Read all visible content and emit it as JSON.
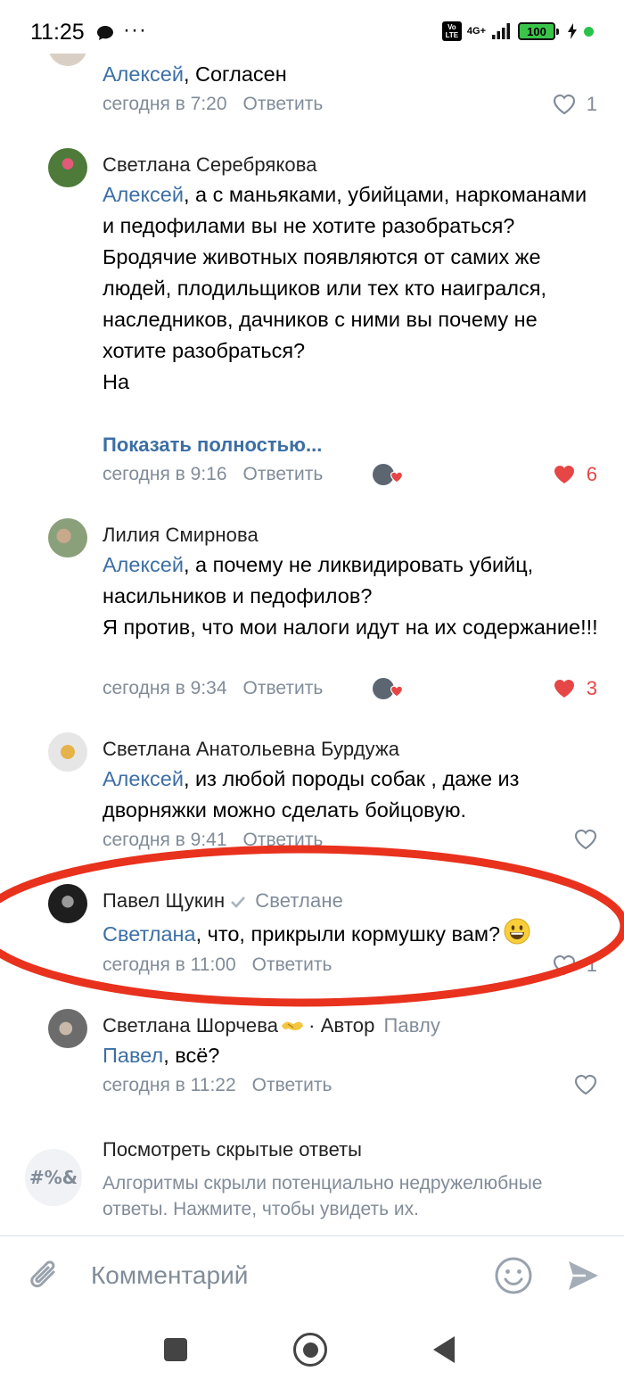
{
  "status_bar": {
    "time": "11:25",
    "volte": "Vo LTE",
    "network": "4G+",
    "battery": "100"
  },
  "comments": [
    {
      "author": "",
      "mention": "Алексей",
      "text": ", Согласен",
      "time": "сегодня в 7:20",
      "reply": "Ответить",
      "likes": "1"
    },
    {
      "author": "Светлана Серебрякова",
      "mention": "Алексей",
      "text": ", а с маньяками, убийцами, наркоманами и педофилами вы не хотите разобраться? Бродячие животных появляются от самих же людей, плодильщиков или тех кто наигрался, наследников, дачников с ними вы почему не хотите разобраться?",
      "text2": "На",
      "show_more": "Показать полностью...",
      "time": "сегодня в 9:16",
      "reply": "Ответить",
      "likes": "6"
    },
    {
      "author": "Лилия Смирнова",
      "mention": "Алексей",
      "text": ", а почему не ликвидировать убийц, насильников и педофилов?",
      "text2": "Я против, что мои налоги идут на их содержание!!!",
      "time": "сегодня в 9:34",
      "reply": "Ответить",
      "likes": "3"
    },
    {
      "author": "Светлана Анатольевна Бурдужа",
      "mention": "Алексей",
      "text": ", из любой породы собак , даже из дворняжки можно сделать бойцовую.",
      "time": "сегодня в 9:41",
      "reply": "Ответить"
    },
    {
      "author": "Павел Щукин",
      "reply_to": "Светлане",
      "mention": "Светлана",
      "text": ", что, прикрыли кормушку вам?",
      "time": "сегодня в 11:00",
      "reply": "Ответить",
      "likes": "1"
    },
    {
      "author": "Светлана Шорчева",
      "author_tag": "· Автор",
      "reply_to": "Павлу",
      "mention": "Павел",
      "text": ", всё?",
      "time": "сегодня в 11:22",
      "reply": "Ответить"
    }
  ],
  "hidden_replies": {
    "icon_text": "#%&",
    "title": "Посмотреть скрытые ответы",
    "subtitle": "Алгоритмы скрыли потенциально недружелюбные ответы. Нажмите, чтобы увидеть их."
  },
  "input": {
    "placeholder": "Комментарий"
  },
  "colors": {
    "link": "#3c6fa5",
    "meta": "#818c99",
    "like_red": "#e64646",
    "annotation_red": "#e8321e"
  }
}
